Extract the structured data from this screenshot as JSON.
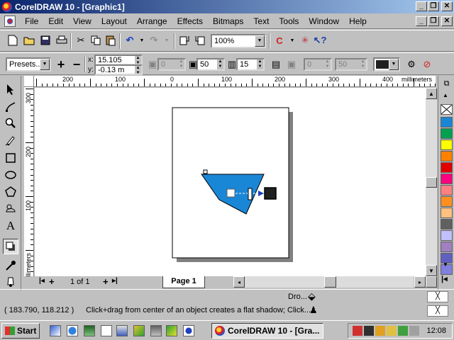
{
  "window": {
    "title": "CorelDRAW 10 - [Graphic1]",
    "min_glyph": "_",
    "max_glyph": "❐",
    "close_glyph": "✕"
  },
  "menu": [
    {
      "label": "File"
    },
    {
      "label": "Edit"
    },
    {
      "label": "View"
    },
    {
      "label": "Layout"
    },
    {
      "label": "Arrange"
    },
    {
      "label": "Effects"
    },
    {
      "label": "Bitmaps"
    },
    {
      "label": "Text"
    },
    {
      "label": "Tools"
    },
    {
      "label": "Window"
    },
    {
      "label": "Help"
    }
  ],
  "standard_toolbar": {
    "zoom_value": "100%"
  },
  "property_bar": {
    "presets_label": "Presets...",
    "x_label": "x:",
    "x_value": "15.105",
    "y_label": "y:",
    "y_value": "-0.13 m",
    "offset_value": "0",
    "opacity_value": "50",
    "feather_value": "15",
    "fade_value": "0",
    "stretch_value": "50",
    "shadow_color": "#202020"
  },
  "rulers": {
    "unit_label": "millimeters",
    "h_ticks": [
      "200",
      "100",
      "0",
      "100",
      "200",
      "300",
      "400"
    ],
    "v_ticks": [
      "300",
      "200",
      "100"
    ]
  },
  "document": {
    "shape_color": "#1a86d6",
    "shadow_end_color": "#202020"
  },
  "palette": {
    "colors": [
      "#1a86d6",
      "#00a050",
      "#ffff00",
      "#ff8000",
      "#e00000",
      "#ff0080",
      "#ff8080",
      "#ff9020",
      "#ffc080",
      "#606060",
      "#c0c0ff",
      "#a080c0",
      "#6060c0",
      "#8080e0"
    ]
  },
  "navigation": {
    "page_count": "1 of 1",
    "page_tab": "Page 1"
  },
  "status": {
    "object_info": "Dro...",
    "coordinates": "( 183.790, 118.212 )",
    "hint": "Click+drag from center of an object creates a flat shadow; Click..."
  },
  "taskbar": {
    "start_label": "Start",
    "task_label": "CorelDRAW 10 - [Gra...",
    "clock": "12:08"
  }
}
